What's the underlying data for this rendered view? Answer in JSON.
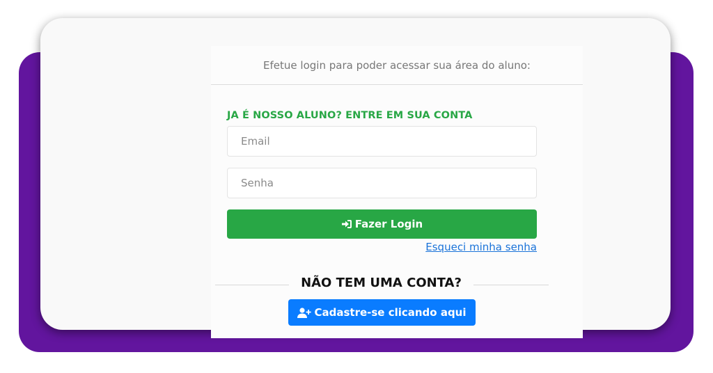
{
  "intro": {
    "text": "Efetue login para poder acessar sua área do aluno:"
  },
  "login": {
    "section_title": "JA É NOSSO ALUNO? ENTRE EM SUA CONTA",
    "email_placeholder": "Email",
    "email_value": "",
    "password_placeholder": "Senha",
    "password_value": "",
    "button_label": "Fazer Login",
    "button_icon": "sign-in-icon",
    "forgot_link": "Esqueci minha senha"
  },
  "signup": {
    "heading": "NÃO TEM UMA CONTA?",
    "button_label": "Cadastre-se clicando aqui",
    "button_icon": "user-plus-icon"
  },
  "colors": {
    "backdrop": "#62159e",
    "success": "#28a745",
    "primary": "#0a7cff",
    "link": "#1a73d9"
  }
}
